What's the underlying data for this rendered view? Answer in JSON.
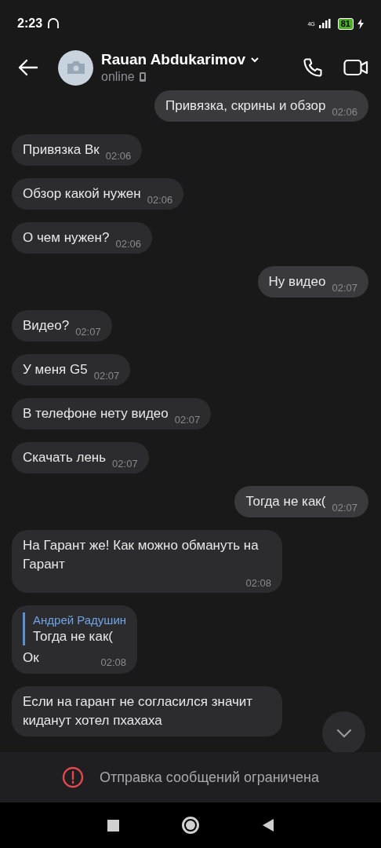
{
  "status_bar": {
    "time": "2:23",
    "network": "4G",
    "battery": "81"
  },
  "header": {
    "name": "Rauan Abdukarimov",
    "status": "online"
  },
  "messages": [
    {
      "outgoing": true,
      "text": "Привязка, скрины и обзор",
      "time": "02:06"
    },
    {
      "outgoing": false,
      "text": "Привязка Вк",
      "time": "02:06"
    },
    {
      "outgoing": false,
      "text": "Обзор какой нужен",
      "time": "02:06"
    },
    {
      "outgoing": false,
      "text": "О чем нужен?",
      "time": "02:06"
    },
    {
      "outgoing": true,
      "text": "Ну видео",
      "time": "02:07"
    },
    {
      "outgoing": false,
      "text": "Видео?",
      "time": "02:07"
    },
    {
      "outgoing": false,
      "text": "У меня G5",
      "time": "02:07"
    },
    {
      "outgoing": false,
      "text": "В телефоне нету видео",
      "time": "02:07"
    },
    {
      "outgoing": false,
      "text": "Скачать лень",
      "time": "02:07"
    },
    {
      "outgoing": true,
      "text": "Тогда не как(",
      "time": "02:07"
    },
    {
      "outgoing": false,
      "text": "На Гарант же! Как можно обмануть на Гарант",
      "time": "02:08"
    },
    {
      "outgoing": false,
      "reply": {
        "author": "Андрей Радушин",
        "text": "Тогда не как("
      },
      "text": "Ок",
      "time": "02:08"
    },
    {
      "outgoing": false,
      "text": "Если на гарант не согласился значит киданут хотел пхахаха"
    }
  ],
  "notice": "Отправка сообщений ограничена"
}
